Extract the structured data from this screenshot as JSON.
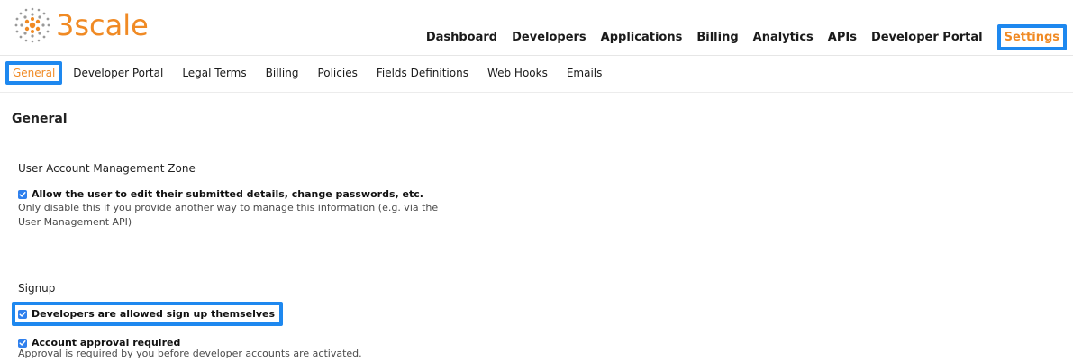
{
  "brand": {
    "name": "3scale",
    "accent": "#f08a24",
    "highlight": "#1e88ef"
  },
  "main_nav": {
    "items": [
      {
        "label": "Dashboard"
      },
      {
        "label": "Developers"
      },
      {
        "label": "Applications"
      },
      {
        "label": "Billing"
      },
      {
        "label": "Analytics"
      },
      {
        "label": "APIs"
      },
      {
        "label": "Developer Portal"
      },
      {
        "label": "Settings",
        "active": true
      }
    ]
  },
  "sub_nav": {
    "items": [
      {
        "label": "General",
        "active": true
      },
      {
        "label": "Developer Portal"
      },
      {
        "label": "Legal Terms"
      },
      {
        "label": "Billing"
      },
      {
        "label": "Policies"
      },
      {
        "label": "Fields Definitions"
      },
      {
        "label": "Web Hooks"
      },
      {
        "label": "Emails"
      }
    ]
  },
  "page": {
    "title": "General"
  },
  "account_zone": {
    "heading": "User Account Management Zone",
    "option": {
      "label": "Allow the user to edit their submitted details, change passwords, etc.",
      "checked": true,
      "hint_line1": "Only disable this if you provide another way to manage this information (e.g. via the",
      "hint_line2": "User Management API)"
    }
  },
  "signup": {
    "heading": "Signup",
    "self_signup": {
      "label": "Developers are allowed sign up themselves",
      "checked": true
    },
    "approval": {
      "label": "Account approval required",
      "checked": true,
      "hint": "Approval is required by you before developer accounts are activated."
    }
  }
}
